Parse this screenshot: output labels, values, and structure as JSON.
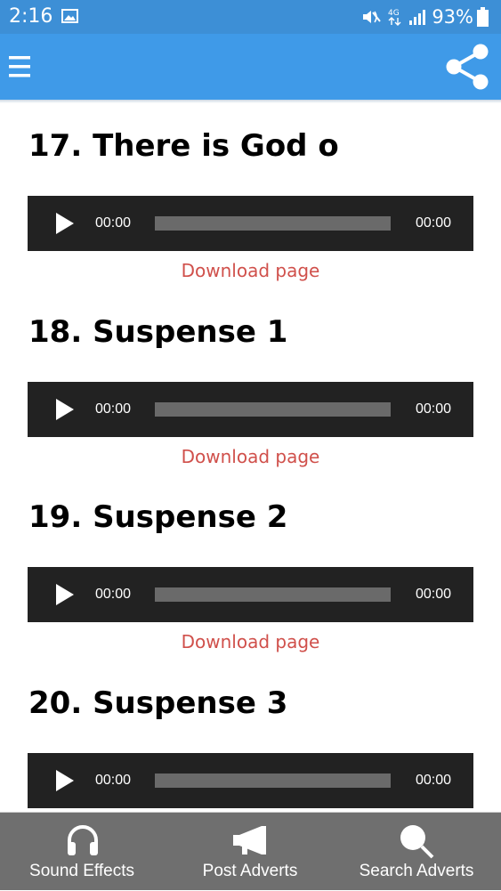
{
  "status_bar": {
    "time": "2:16",
    "battery": "93%",
    "network": "4G",
    "icons": [
      "gallery-icon",
      "mute-vibrate-icon",
      "network-4g-icon",
      "signal-icon",
      "battery-icon"
    ]
  },
  "app_bar": {
    "background": "#3f9ae8",
    "icons": [
      "menu-icon",
      "share-icon"
    ]
  },
  "tracks": [
    {
      "title": "17. There is God o",
      "current_time": "00:00",
      "total_time": "00:00",
      "download_label": "Download page"
    },
    {
      "title": "18. Suspense 1",
      "current_time": "00:00",
      "total_time": "00:00",
      "download_label": "Download page"
    },
    {
      "title": "19. Suspense 2",
      "current_time": "00:00",
      "total_time": "00:00",
      "download_label": "Download page"
    },
    {
      "title": "20. Suspense 3",
      "current_time": "00:00",
      "total_time": "00:00",
      "download_label": ""
    }
  ],
  "bottom_nav": {
    "items": [
      {
        "label": "Sound Effects",
        "icon": "headphones-icon"
      },
      {
        "label": "Post Adverts",
        "icon": "megaphone-icon"
      },
      {
        "label": "Search Adverts",
        "icon": "search-icon"
      }
    ]
  },
  "colors": {
    "status_bar": "#3d8fd6",
    "app_bar": "#3f9ae8",
    "player_bg": "#222222",
    "progress": "#6a6a6a",
    "download_link": "#d0504b",
    "bottom_nav": "#6f6f6f"
  }
}
